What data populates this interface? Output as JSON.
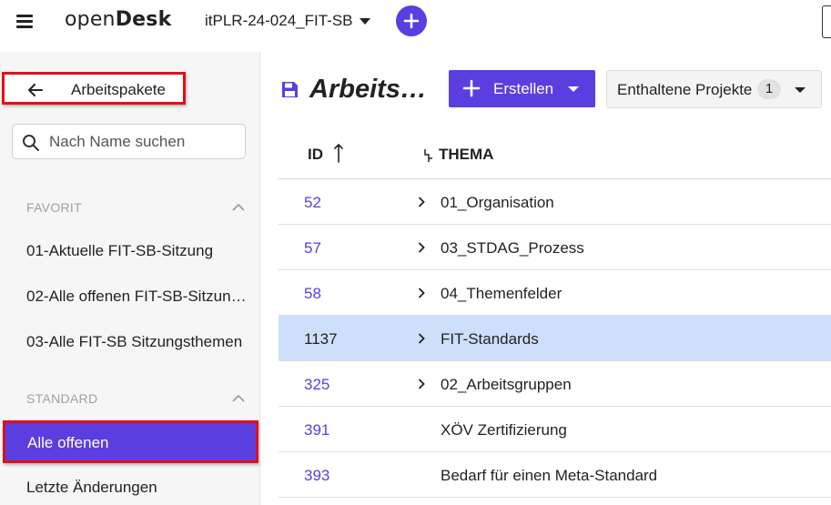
{
  "app": {
    "logo_prefix": "open",
    "logo_suffix": "Desk",
    "project": "itPLR-24-024_FIT-SB"
  },
  "sidebar": {
    "back_label": "Arbeitspakete",
    "search_placeholder": "Nach Name suchen",
    "sections": [
      {
        "title": "FAVORIT",
        "items": [
          "01-Aktuelle FIT-SB-Sitzung",
          "02-Alle offenen FIT-SB-Sitzun…",
          "03-Alle FIT-SB Sitzungsthemen"
        ]
      },
      {
        "title": "STANDARD",
        "items": [
          "Alle offenen",
          "Letzte Änderungen"
        ]
      }
    ]
  },
  "main": {
    "title": "Arbeits…",
    "create_label": "Erstellen",
    "projects_label": "Enthaltene Projekte",
    "projects_count": "1",
    "table": {
      "col_id": "ID",
      "col_thema": "THEMA",
      "rows": [
        {
          "id": "52",
          "thema": "01_Organisation",
          "expandable": true,
          "selected": false
        },
        {
          "id": "57",
          "thema": "03_STDAG_Prozess",
          "expandable": true,
          "selected": false
        },
        {
          "id": "58",
          "thema": "04_Themenfelder",
          "expandable": true,
          "selected": false
        },
        {
          "id": "1137",
          "thema": "FIT-Standards",
          "expandable": true,
          "selected": true
        },
        {
          "id": "325",
          "thema": "02_Arbeitsgruppen",
          "expandable": true,
          "selected": false
        },
        {
          "id": "391",
          "thema": "XÖV Zertifizierung",
          "expandable": false,
          "selected": false
        },
        {
          "id": "393",
          "thema": "Bedarf für einen Meta-Standard",
          "expandable": false,
          "selected": false
        }
      ]
    }
  },
  "colors": {
    "accent": "#5b3ee0",
    "highlight_border": "#e0101a",
    "selected_row": "#cddffb"
  }
}
